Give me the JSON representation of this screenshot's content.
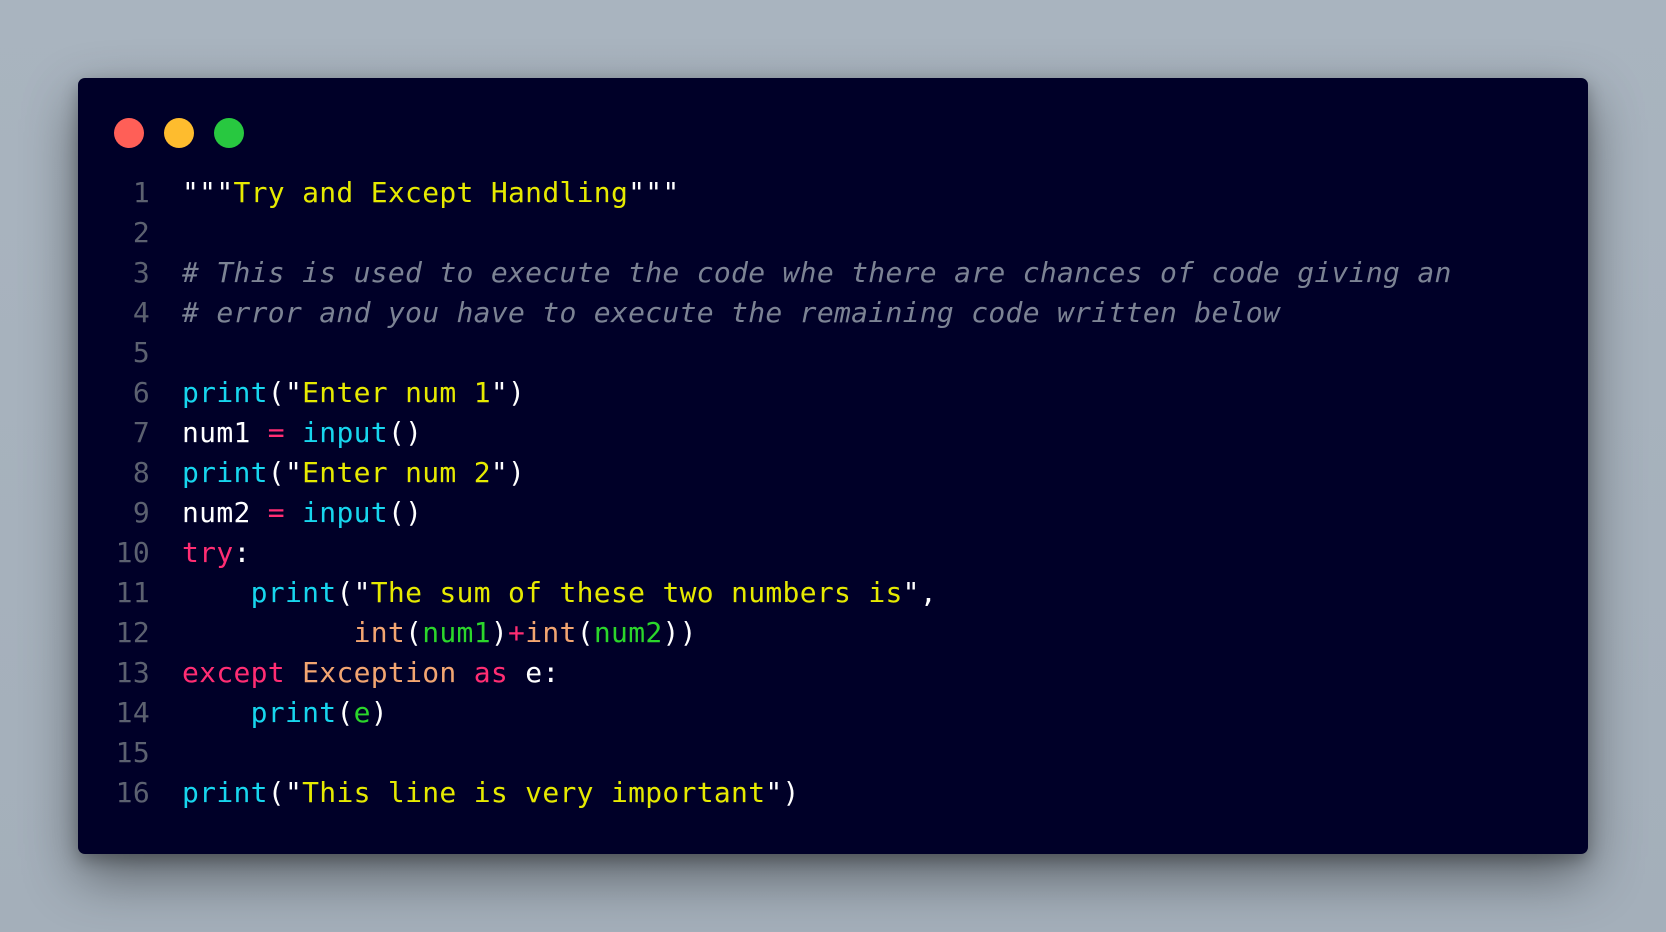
{
  "window": {
    "controls": [
      {
        "name": "close-dot",
        "color": "#ff5f57"
      },
      {
        "name": "minimize-dot",
        "color": "#febc2e"
      },
      {
        "name": "maximize-dot",
        "color": "#28c840"
      }
    ]
  },
  "colors": {
    "background": "#000028",
    "line_number": "#5c6170",
    "string": "#e6ea00",
    "comment": "#7c8394",
    "function": "#17d6ee",
    "keyword": "#ff2d73",
    "default": "#ffffff",
    "class": "#f2a571",
    "variable_arg": "#2bd62b"
  },
  "code": {
    "lines": [
      {
        "num": "1",
        "tokens": [
          {
            "t": "\"\"\"",
            "c": "default"
          },
          {
            "t": "Try and Except Handling",
            "c": "string"
          },
          {
            "t": "\"\"\"",
            "c": "default"
          }
        ]
      },
      {
        "num": "2",
        "tokens": []
      },
      {
        "num": "3",
        "tokens": [
          {
            "t": "# This is used to execute the code whe there are chances of code giving an",
            "c": "comment",
            "italic": true
          }
        ]
      },
      {
        "num": "4",
        "tokens": [
          {
            "t": "# error and you have to execute the remaining code written below",
            "c": "comment",
            "italic": true
          }
        ]
      },
      {
        "num": "5",
        "tokens": []
      },
      {
        "num": "6",
        "tokens": [
          {
            "t": "print",
            "c": "function"
          },
          {
            "t": "(\"",
            "c": "default"
          },
          {
            "t": "Enter num 1",
            "c": "string"
          },
          {
            "t": "\")",
            "c": "default"
          }
        ]
      },
      {
        "num": "7",
        "tokens": [
          {
            "t": "num1 ",
            "c": "default"
          },
          {
            "t": "=",
            "c": "keyword"
          },
          {
            "t": " ",
            "c": "default"
          },
          {
            "t": "input",
            "c": "function"
          },
          {
            "t": "()",
            "c": "default"
          }
        ]
      },
      {
        "num": "8",
        "tokens": [
          {
            "t": "print",
            "c": "function"
          },
          {
            "t": "(\"",
            "c": "default"
          },
          {
            "t": "Enter num 2",
            "c": "string"
          },
          {
            "t": "\")",
            "c": "default"
          }
        ]
      },
      {
        "num": "9",
        "tokens": [
          {
            "t": "num2 ",
            "c": "default"
          },
          {
            "t": "=",
            "c": "keyword"
          },
          {
            "t": " ",
            "c": "default"
          },
          {
            "t": "input",
            "c": "function"
          },
          {
            "t": "()",
            "c": "default"
          }
        ]
      },
      {
        "num": "10",
        "tokens": [
          {
            "t": "try",
            "c": "keyword"
          },
          {
            "t": ":",
            "c": "default"
          }
        ]
      },
      {
        "num": "11",
        "tokens": [
          {
            "t": "    ",
            "c": "default"
          },
          {
            "t": "print",
            "c": "function"
          },
          {
            "t": "(\"",
            "c": "default"
          },
          {
            "t": "The sum of these two numbers is",
            "c": "string"
          },
          {
            "t": "\",",
            "c": "default"
          }
        ]
      },
      {
        "num": "12",
        "tokens": [
          {
            "t": "          ",
            "c": "default"
          },
          {
            "t": "int",
            "c": "class"
          },
          {
            "t": "(",
            "c": "default"
          },
          {
            "t": "num1",
            "c": "variable_arg"
          },
          {
            "t": ")",
            "c": "default"
          },
          {
            "t": "+",
            "c": "keyword"
          },
          {
            "t": "int",
            "c": "class"
          },
          {
            "t": "(",
            "c": "default"
          },
          {
            "t": "num2",
            "c": "variable_arg"
          },
          {
            "t": "))",
            "c": "default"
          }
        ]
      },
      {
        "num": "13",
        "tokens": [
          {
            "t": "except",
            "c": "keyword"
          },
          {
            "t": " ",
            "c": "default"
          },
          {
            "t": "Exception",
            "c": "class"
          },
          {
            "t": " ",
            "c": "default"
          },
          {
            "t": "as",
            "c": "keyword"
          },
          {
            "t": " e:",
            "c": "default"
          }
        ]
      },
      {
        "num": "14",
        "tokens": [
          {
            "t": "    ",
            "c": "default"
          },
          {
            "t": "print",
            "c": "function"
          },
          {
            "t": "(",
            "c": "default"
          },
          {
            "t": "e",
            "c": "variable_arg"
          },
          {
            "t": ")",
            "c": "default"
          }
        ]
      },
      {
        "num": "15",
        "tokens": []
      },
      {
        "num": "16",
        "tokens": [
          {
            "t": "print",
            "c": "function"
          },
          {
            "t": "(\"",
            "c": "default"
          },
          {
            "t": "This line is very important",
            "c": "string"
          },
          {
            "t": "\")",
            "c": "default"
          }
        ]
      }
    ]
  }
}
